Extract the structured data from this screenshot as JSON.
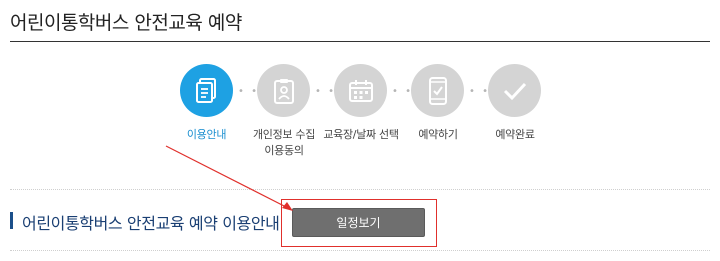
{
  "page": {
    "title": "어린이통학버스 안전교육 예약"
  },
  "steps": [
    {
      "label_line1": "이용안내",
      "label_line2": "",
      "icon": "document-icon",
      "active": true
    },
    {
      "label_line1": "개인정보 수집",
      "label_line2": "이용동의",
      "icon": "clipboard-person-icon",
      "active": false
    },
    {
      "label_line1": "교육장/날짜 선택",
      "label_line2": "",
      "icon": "calendar-icon",
      "active": false
    },
    {
      "label_line1": "예약하기",
      "label_line2": "",
      "icon": "mobile-check-icon",
      "active": false
    },
    {
      "label_line1": "예약완료",
      "label_line2": "",
      "icon": "checkmark-icon",
      "active": false
    }
  ],
  "section": {
    "title": "어린이통학버스 안전교육 예약 이용안내"
  },
  "schedule_button": {
    "label": "일정보기"
  },
  "colors": {
    "active_step": "#1ea1e3",
    "inactive_step": "#d4d4d4",
    "section_title": "#1a3f73",
    "button": "#6f6f6f",
    "annotation": "#e0302c"
  }
}
